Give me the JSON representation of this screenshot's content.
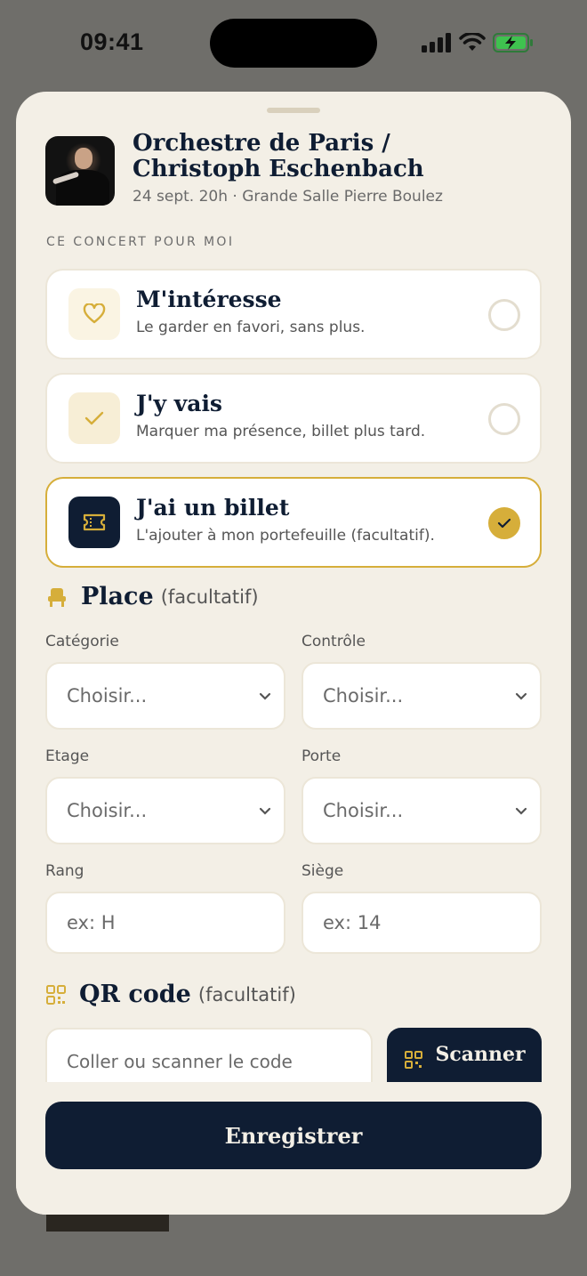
{
  "status": {
    "time": "09:41"
  },
  "event": {
    "title": "Orchestre de Paris / Christoph Eschenbach",
    "subtitle": "24 sept. 20h · Grande Salle Pierre Boulez"
  },
  "section_label": "CE CONCERT POUR MOI",
  "options": [
    {
      "title": "M'intéresse",
      "desc": "Le garder en favori, sans plus.",
      "icon": "heart-icon",
      "selected": false
    },
    {
      "title": "J'y vais",
      "desc": "Marquer ma présence, billet plus tard.",
      "icon": "check-icon",
      "selected": false
    },
    {
      "title": "J'ai un billet",
      "desc": "L'ajouter à mon portefeuille (facultatif).",
      "icon": "ticket-icon",
      "selected": true
    }
  ],
  "place": {
    "heading": "Place",
    "optional": "(facultatif)",
    "fields": {
      "categorie": {
        "label": "Catégorie",
        "value": "Choisir..."
      },
      "controle": {
        "label": "Contrôle",
        "value": "Choisir..."
      },
      "etage": {
        "label": "Etage",
        "value": "Choisir..."
      },
      "porte": {
        "label": "Porte",
        "value": "Choisir..."
      },
      "rang": {
        "label": "Rang",
        "placeholder": "ex: H"
      },
      "siege": {
        "label": "Siège",
        "placeholder": "ex: 14"
      }
    }
  },
  "qr": {
    "heading": "QR code",
    "optional": "(facultatif)",
    "placeholder": "Coller ou scanner le code",
    "scan_label": "Scanner"
  },
  "save_label": "Enregistrer",
  "colors": {
    "navy": "#0f1d33",
    "gold": "#d6ae3a",
    "sheet": "#f3efe6"
  }
}
